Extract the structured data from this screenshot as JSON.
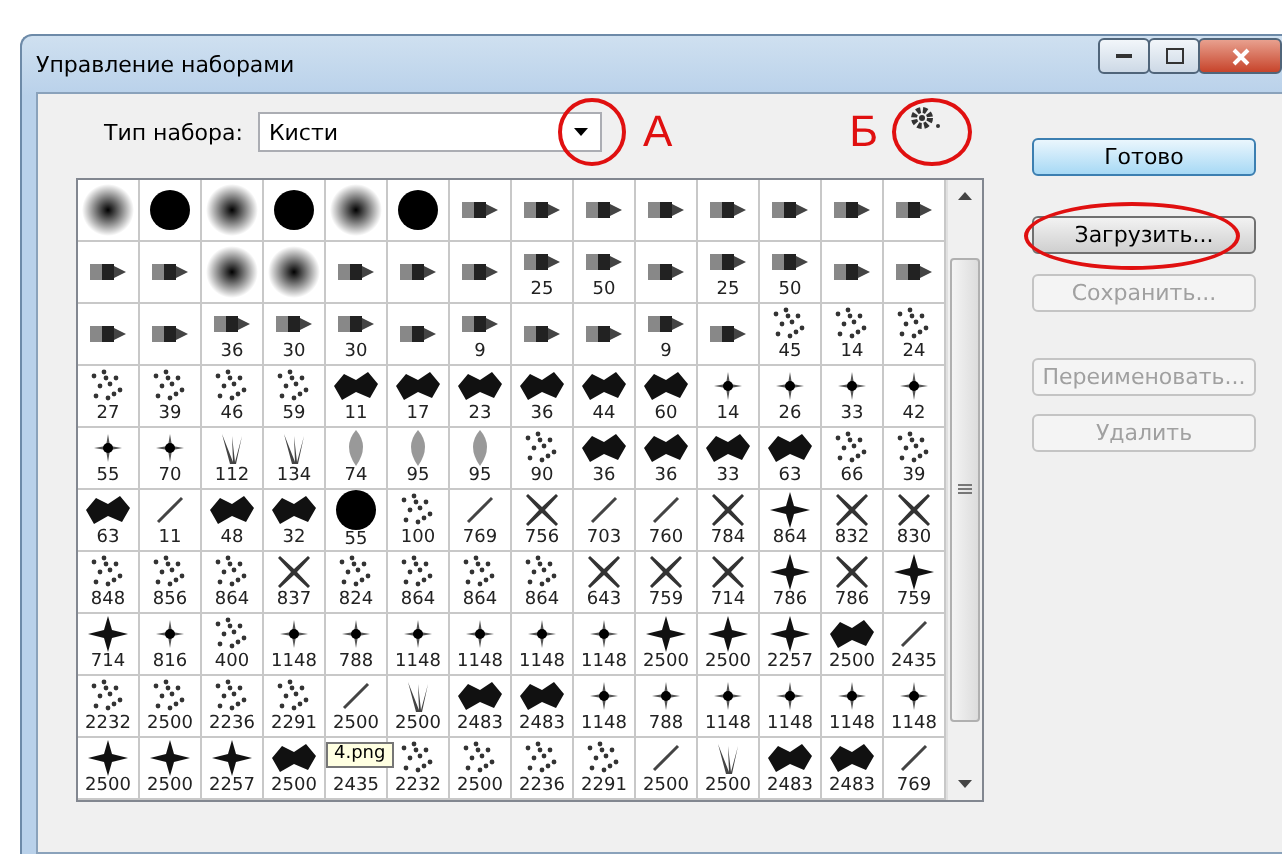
{
  "window": {
    "title": "Управление наборами"
  },
  "preset_type": {
    "label": "Тип набора:",
    "value": "Кисти",
    "circled": true
  },
  "gear_menu": {
    "circled": true
  },
  "annotations": [
    {
      "text": "А"
    },
    {
      "text": "Б"
    }
  ],
  "grid": {
    "rows": [
      [
        {
          "kind": "soft"
        },
        {
          "kind": "hard"
        },
        {
          "kind": "soft"
        },
        {
          "kind": "hard"
        },
        {
          "kind": "soft"
        },
        {
          "kind": "hard"
        },
        {
          "kind": "tip"
        },
        {
          "kind": "tip"
        },
        {
          "kind": "tip"
        },
        {
          "kind": "tip"
        },
        {
          "kind": "tip"
        },
        {
          "kind": "tip"
        },
        {
          "kind": "tip"
        },
        {
          "kind": "tip"
        }
      ],
      [
        {
          "kind": "tip"
        },
        {
          "kind": "tip"
        },
        {
          "kind": "soft"
        },
        {
          "kind": "soft"
        },
        {
          "kind": "tip"
        },
        {
          "kind": "tip"
        },
        {
          "kind": "tip"
        },
        {
          "kind": "tip",
          "label": "25"
        },
        {
          "kind": "tip",
          "label": "50"
        },
        {
          "kind": "tip"
        },
        {
          "kind": "tip",
          "label": "25"
        },
        {
          "kind": "tip",
          "label": "50"
        },
        {
          "kind": "tip"
        },
        {
          "kind": "tip"
        }
      ],
      [
        {
          "kind": "tip"
        },
        {
          "kind": "tip"
        },
        {
          "kind": "tip",
          "label": "36"
        },
        {
          "kind": "tip",
          "label": "30"
        },
        {
          "kind": "tip",
          "label": "30"
        },
        {
          "kind": "tip"
        },
        {
          "kind": "tip",
          "label": "9"
        },
        {
          "kind": "tip"
        },
        {
          "kind": "tip"
        },
        {
          "kind": "tip",
          "label": "9"
        },
        {
          "kind": "tip"
        },
        {
          "kind": "scatter",
          "label": "45"
        },
        {
          "kind": "scatter",
          "label": "14"
        },
        {
          "kind": "scatter",
          "label": "24"
        }
      ],
      [
        {
          "kind": "scatter",
          "label": "27"
        },
        {
          "kind": "scatter",
          "label": "39"
        },
        {
          "kind": "scatter",
          "label": "46"
        },
        {
          "kind": "scatter",
          "label": "59"
        },
        {
          "kind": "blot",
          "label": "11"
        },
        {
          "kind": "blot",
          "label": "17"
        },
        {
          "kind": "blot",
          "label": "23"
        },
        {
          "kind": "blot",
          "label": "36"
        },
        {
          "kind": "blot",
          "label": "44"
        },
        {
          "kind": "blot",
          "label": "60"
        },
        {
          "kind": "dot",
          "label": "14"
        },
        {
          "kind": "dot",
          "label": "26"
        },
        {
          "kind": "dot",
          "label": "33"
        },
        {
          "kind": "dot",
          "label": "42"
        }
      ],
      [
        {
          "kind": "dot",
          "label": "55"
        },
        {
          "kind": "dot",
          "label": "70"
        },
        {
          "kind": "grass",
          "label": "112"
        },
        {
          "kind": "grass",
          "label": "134"
        },
        {
          "kind": "leaf",
          "label": "74"
        },
        {
          "kind": "leaf",
          "label": "95"
        },
        {
          "kind": "leaf",
          "label": "95"
        },
        {
          "kind": "scatter",
          "label": "90"
        },
        {
          "kind": "blot",
          "label": "36"
        },
        {
          "kind": "blot",
          "label": "36"
        },
        {
          "kind": "blot",
          "label": "33"
        },
        {
          "kind": "blot",
          "label": "63"
        },
        {
          "kind": "scatter",
          "label": "66"
        },
        {
          "kind": "scatter",
          "label": "39"
        }
      ],
      [
        {
          "kind": "blot",
          "label": "63"
        },
        {
          "kind": "line",
          "label": "11"
        },
        {
          "kind": "blot",
          "label": "48"
        },
        {
          "kind": "blot",
          "label": "32"
        },
        {
          "kind": "hard",
          "label": "55"
        },
        {
          "kind": "scatter",
          "label": "100"
        },
        {
          "kind": "line",
          "label": "769"
        },
        {
          "kind": "cross",
          "label": "756"
        },
        {
          "kind": "line",
          "label": "703"
        },
        {
          "kind": "line",
          "label": "760"
        },
        {
          "kind": "cross",
          "label": "784"
        },
        {
          "kind": "star",
          "label": "864"
        },
        {
          "kind": "cross",
          "label": "832"
        },
        {
          "kind": "cross",
          "label": "830"
        }
      ],
      [
        {
          "kind": "scatter",
          "label": "848"
        },
        {
          "kind": "scatter",
          "label": "856"
        },
        {
          "kind": "scatter",
          "label": "864"
        },
        {
          "kind": "cross",
          "label": "837"
        },
        {
          "kind": "scatter",
          "label": "824"
        },
        {
          "kind": "scatter",
          "label": "864"
        },
        {
          "kind": "scatter",
          "label": "864"
        },
        {
          "kind": "scatter",
          "label": "864"
        },
        {
          "kind": "cross",
          "label": "643"
        },
        {
          "kind": "cross",
          "label": "759"
        },
        {
          "kind": "cross",
          "label": "714"
        },
        {
          "kind": "star",
          "label": "786"
        },
        {
          "kind": "cross",
          "label": "786"
        },
        {
          "kind": "star",
          "label": "759"
        }
      ],
      [
        {
          "kind": "star",
          "label": "714"
        },
        {
          "kind": "dot",
          "label": "816"
        },
        {
          "kind": "scatter",
          "label": "400"
        },
        {
          "kind": "dot",
          "label": "1148"
        },
        {
          "kind": "dot",
          "label": "788"
        },
        {
          "kind": "dot",
          "label": "1148"
        },
        {
          "kind": "dot",
          "label": "1148"
        },
        {
          "kind": "dot",
          "label": "1148"
        },
        {
          "kind": "dot",
          "label": "1148"
        },
        {
          "kind": "star",
          "label": "2500"
        },
        {
          "kind": "star",
          "label": "2500"
        },
        {
          "kind": "star",
          "label": "2257"
        },
        {
          "kind": "blot",
          "label": "2500"
        },
        {
          "kind": "line",
          "label": "2435"
        }
      ],
      [
        {
          "kind": "scatter",
          "label": "2232"
        },
        {
          "kind": "scatter",
          "label": "2500"
        },
        {
          "kind": "scatter",
          "label": "2236"
        },
        {
          "kind": "scatter",
          "label": "2291"
        },
        {
          "kind": "line",
          "label": "2500"
        },
        {
          "kind": "grass",
          "label": "2500"
        },
        {
          "kind": "blot",
          "label": "2483"
        },
        {
          "kind": "blot",
          "label": "2483"
        },
        {
          "kind": "dot",
          "label": "1148"
        },
        {
          "kind": "dot",
          "label": "788"
        },
        {
          "kind": "dot",
          "label": "1148"
        },
        {
          "kind": "dot",
          "label": "1148"
        },
        {
          "kind": "dot",
          "label": "1148"
        },
        {
          "kind": "dot",
          "label": "1148"
        }
      ],
      [
        {
          "kind": "star",
          "label": "2500"
        },
        {
          "kind": "star",
          "label": "2500"
        },
        {
          "kind": "star",
          "label": "2257"
        },
        {
          "kind": "blot",
          "label": "2500"
        },
        {
          "kind": "covered",
          "label": "2435",
          "tooltip": "4.png"
        },
        {
          "kind": "scatter",
          "label": "2232"
        },
        {
          "kind": "scatter",
          "label": "2500"
        },
        {
          "kind": "scatter",
          "label": "2236"
        },
        {
          "kind": "scatter",
          "label": "2291"
        },
        {
          "kind": "line",
          "label": "2500"
        },
        {
          "kind": "grass",
          "label": "2500"
        },
        {
          "kind": "blot",
          "label": "2483"
        },
        {
          "kind": "blot",
          "label": "2483"
        },
        {
          "kind": "line",
          "label": "769"
        }
      ]
    ]
  },
  "buttons": [
    {
      "label": "Готово",
      "default": true,
      "disabled": false,
      "circled": false
    },
    {
      "label": "Загрузить...",
      "default": false,
      "disabled": false,
      "circled": true
    },
    {
      "label": "Сохранить...",
      "default": false,
      "disabled": true,
      "circled": false
    },
    {
      "label": "Переименовать...",
      "default": false,
      "disabled": true,
      "circled": false
    },
    {
      "label": "Удалить",
      "default": false,
      "disabled": true,
      "circled": false
    }
  ]
}
